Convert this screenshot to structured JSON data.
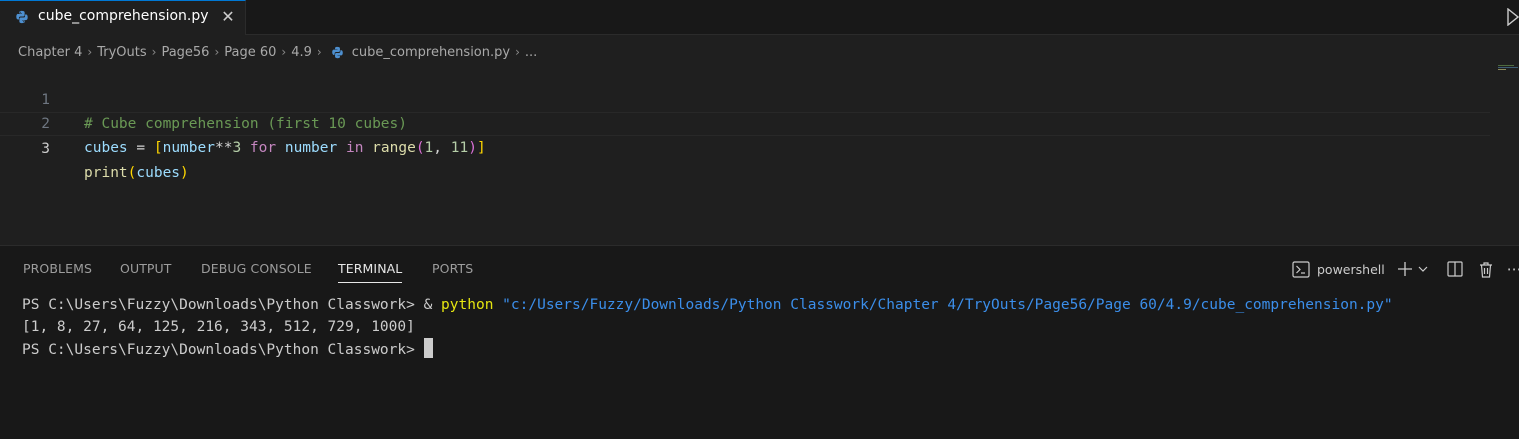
{
  "tab": {
    "filename": "cube_comprehension.py",
    "close": "✕"
  },
  "breadcrumb": {
    "items": [
      "Chapter 4",
      "TryOuts",
      "Page56",
      "Page 60",
      "4.9"
    ],
    "file": "cube_comprehension.py",
    "more": "..."
  },
  "editor": {
    "lines": [
      {
        "number": "1",
        "comment": "# Cube comprehension (first 10 cubes)"
      },
      {
        "number": "2",
        "var": "cubes",
        "eq": " = ",
        "br_open": "[",
        "t1": "number",
        "op": "**",
        "n3": "3",
        "kw_for": " for ",
        "t2": "number",
        "kw_in": " in ",
        "fn": "range",
        "p_open": "(",
        "n1": "1",
        "comma": ", ",
        "n11": "11",
        "p_close": ")",
        "br_close": "]"
      },
      {
        "number": "3",
        "fn": "print",
        "p_open": "(",
        "arg": "cubes",
        "p_close": ")"
      }
    ]
  },
  "panel": {
    "tabs": [
      "PROBLEMS",
      "OUTPUT",
      "DEBUG CONSOLE",
      "TERMINAL",
      "PORTS"
    ],
    "active_tab": "TERMINAL",
    "shell": "powershell"
  },
  "terminal": {
    "prompt": "PS C:\\Users\\Fuzzy\\Downloads\\Python Classwork> ",
    "amp": "& ",
    "cmd": "python",
    "arg": " \"c:/Users/Fuzzy/Downloads/Python Classwork/Chapter 4/TryOuts/Page56/Page 60/4.9/cube_comprehension.py\"",
    "output": "[1, 8, 27, 64, 125, 216, 343, 512, 729, 1000]",
    "prompt2": "PS C:\\Users\\Fuzzy\\Downloads\\Python Classwork> "
  },
  "colors": {
    "accent": "#0078d4",
    "background": "#1f1f1f",
    "panel": "#181818"
  }
}
